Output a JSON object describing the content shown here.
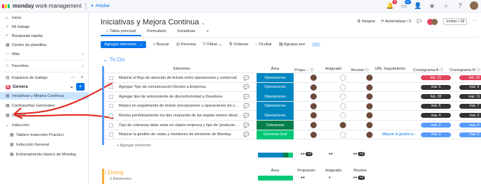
{
  "header": {
    "brand_bold": "monday",
    "brand_rest": "work management",
    "upgrade": "Ampliar",
    "notif_count": "1",
    "inbox_count": "41",
    "notif_icon": "bell-icon",
    "inbox_icon": "inbox-icon",
    "people_icon": "person-add-icon",
    "apps_icon": "puzzle-icon",
    "search_icon": "search-icon",
    "help_icon": "help-icon"
  },
  "sidebar": {
    "top": [
      "Inicio",
      "Mi trabajo",
      "Búsqueda rápida",
      "Centro de plantillas"
    ],
    "more": "Más",
    "favoritos": "Favoritos",
    "espacios": "Espacios de trabajo",
    "workspace": "Genera",
    "items": [
      {
        "label": "Iniciativas y Mejora Continua",
        "active": true
      },
      {
        "label": "Contraseñas Generales"
      },
      {
        "label": "Combis"
      },
      {
        "label": "Inducción"
      },
      {
        "label": "Tablero Inducción Practico"
      },
      {
        "label": "Inducción General"
      },
      {
        "label": "Entrenamiento básico de Monday"
      }
    ]
  },
  "board": {
    "title": "Iniciativas y Mejora Continua",
    "tabs": [
      "Tabla principal",
      "Formulario",
      "Iniciativas"
    ],
    "add_tab": "+",
    "integrar": "Integrar",
    "automatizar": "Automatizar / 5",
    "invitar": "Invitar / 18"
  },
  "toolbar": {
    "add": "Agregar elemento",
    "buscar": "Buscar",
    "persona": "Persona",
    "filtrar": "Filtrar",
    "ordenar": "Ordenar",
    "ocultar": "Ocultar",
    "agrupar": "Agrupar por",
    "more": "···"
  },
  "group1": {
    "title": "To Do",
    "color": "#579bfc"
  },
  "columns": [
    "Elemento",
    "Área",
    "Propu…",
    "Asignado",
    "Review",
    "URL Seguimiento",
    "Cronograma A",
    "Cronograma R"
  ],
  "rows": [
    {
      "item": "Mejorar el flujo de atención de tickets entre operaciones y comercial",
      "area": "Operaciones",
      "area_color": "#0086c0",
      "url": "",
      "crA": "feb. 21",
      "crA_color": "#e2445c",
      "crR": "feb. 26",
      "crR_color": "#e2445c"
    },
    {
      "item": "Agregar Tipo de comunicación Deudor a Empresa",
      "area": "Operaciones",
      "area_color": "#0086c0",
      "url": "",
      "crA": "mar. 5",
      "crA_color": "#333333",
      "crR": "mar. 6",
      "crR_color": "#333333"
    },
    {
      "item": "Agregar tipo de antecedente de disconformidad a Deudores",
      "area": "Operaciones",
      "area_color": "#0086c0",
      "url": "",
      "crA": "feb. 28",
      "crA_color": "#333333",
      "crR": "mar. 11",
      "crR_color": "#333333"
    },
    {
      "item": "Mejora en seguimiento de tickets (excepciones u operaciones sin c…",
      "area": "Operaciones",
      "area_color": "#0086c0",
      "url": "",
      "crA": "mar. 6",
      "crA_color": "#333333",
      "crR": "mar. 7",
      "crR_color": "#333333"
    },
    {
      "item": "Revisa periódicamente los tipo respuesta de las duplas emisor-deud…",
      "area": "Operaciones",
      "area_color": "#0086c0",
      "url": "",
      "crA": "mar. 4",
      "crA_color": "#333333",
      "crR": "mar. 5",
      "crR_color": "#333333"
    },
    {
      "item": "Tipo de cobranza debe estar en objeto empresa y tipo de 'producto …",
      "area": "Cobranzas",
      "area_color": "#037f4c",
      "url": "",
      "crA": "mar. 3",
      "crA_color": "#579bfc",
      "crR": "mar. 4",
      "crR_color": "#579bfc"
    },
    {
      "item": "Mejorar la gestión de vistas y monitoreo de elemento de Monday",
      "area": "Gerencia Gral",
      "area_color": "#00c875",
      "url": "Mejorar la gestión d…",
      "crA": "mar. 3",
      "crA_color": "#579bfc",
      "crR": "mar. 3",
      "crR_color": "#579bfc"
    }
  ],
  "add_item": "+ Agregar elemento",
  "summary": {
    "count_badge": "+2",
    "count_badge2": "+2"
  },
  "group2": {
    "title": "Doing",
    "count": "2 Elementos",
    "color": "#fdab3d",
    "cols": [
      "Área",
      "Propuesto",
      "Asignado",
      "Review"
    ],
    "badge": "+2"
  },
  "colors": {
    "accent": "#0073ea"
  }
}
